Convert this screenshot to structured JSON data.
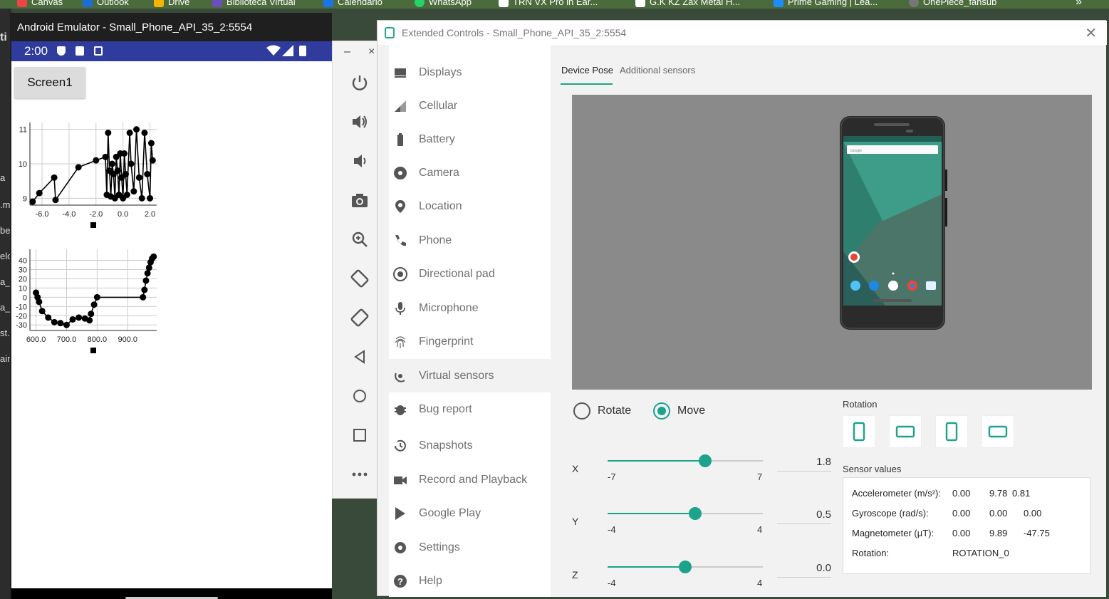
{
  "bookmarks": [
    {
      "label": "Canvas",
      "color": "#e44"
    },
    {
      "label": "Outlook",
      "color": "#1a6fd4"
    },
    {
      "label": "Drive",
      "color": "#f4b400"
    },
    {
      "label": "Biblioteca Virtual",
      "color": "#6b4fbb"
    },
    {
      "label": "Calendario",
      "color": "#1a73e8"
    },
    {
      "label": "WhatsApp",
      "color": "#25d366"
    },
    {
      "label": "TRN VX Pro in Ear...",
      "color": "#111"
    },
    {
      "label": "G.K KZ Zax Metal H...",
      "color": "#111"
    },
    {
      "label": "Prime Gaming | Lea...",
      "color": "#1a8cff"
    },
    {
      "label": "OnePiece_fansub",
      "color": "#777"
    }
  ],
  "bookmarks_more": "»",
  "background_strip": [
    "ti",
    "a",
    ".m",
    "be.",
    "elo",
    "a_l",
    "a_l",
    "st.",
    "ain"
  ],
  "emulator": {
    "title": "Android Emulator - Small_Phone_API_35_2:5554",
    "status_time": "2:00",
    "screen_button": "Screen1",
    "toolbar_window_controls": [
      "–",
      "×"
    ]
  },
  "charts": [
    {
      "type": "line",
      "x_ticks": [
        "-6.0",
        "-4.0",
        "-2.0",
        "0.0",
        "2.0"
      ],
      "y_ticks": [
        "9",
        "10",
        "11"
      ],
      "xlim": [
        -6.9,
        2.5
      ],
      "ylim": [
        8.8,
        11.2
      ],
      "x": [
        -6.7,
        -6.2,
        -5.1,
        -5.0,
        -3.3,
        -2.0,
        -1.3,
        -1.2,
        -1.1,
        -1.0,
        -0.9,
        -0.8,
        -0.7,
        -0.6,
        -0.5,
        -0.4,
        -0.3,
        -0.2,
        -0.1,
        0.0,
        0.1,
        0.2,
        0.3,
        0.5,
        0.6,
        0.8,
        1.0,
        1.2,
        1.4,
        1.6,
        1.8,
        2.0,
        2.1,
        2.2
      ],
      "y": [
        8.9,
        9.15,
        9.6,
        8.95,
        9.9,
        10.1,
        10.2,
        9.1,
        10.9,
        9.8,
        9.05,
        10.0,
        9.7,
        9.0,
        10.2,
        9.8,
        9.1,
        10.3,
        9.6,
        9.0,
        10.3,
        9.7,
        9.1,
        10.9,
        10.0,
        9.2,
        11.0,
        9.6,
        9.0,
        10.9,
        9.7,
        9.0,
        10.6,
        10.1
      ]
    },
    {
      "type": "line",
      "x_ticks": [
        "600.0",
        "700.0",
        "800.0",
        "900.0"
      ],
      "y_ticks": [
        "40",
        "30",
        "20",
        "10",
        "0",
        "-10",
        "-20",
        "-30"
      ],
      "xlim": [
        580,
        995
      ],
      "ylim": [
        -36,
        52
      ],
      "x": [
        600,
        605,
        610,
        620,
        640,
        660,
        680,
        700,
        720,
        740,
        760,
        775,
        780,
        790,
        800,
        950,
        955,
        960,
        965,
        970,
        975,
        980,
        985
      ],
      "y": [
        5,
        0,
        -5,
        -15,
        -22,
        -27,
        -28,
        -30,
        -24,
        -22,
        -23,
        -25,
        -18,
        -8,
        0,
        0,
        8,
        18,
        26,
        32,
        38,
        42,
        44
      ]
    }
  ],
  "extended": {
    "title": "Extended Controls - Small_Phone_API_35_2:5554",
    "nav": [
      {
        "label": "Displays",
        "icon": "display-icon"
      },
      {
        "label": "Cellular",
        "icon": "cellular-icon"
      },
      {
        "label": "Battery",
        "icon": "battery-icon"
      },
      {
        "label": "Camera",
        "icon": "camera-icon"
      },
      {
        "label": "Location",
        "icon": "location-icon"
      },
      {
        "label": "Phone",
        "icon": "phone-icon"
      },
      {
        "label": "Directional pad",
        "icon": "dpad-icon"
      },
      {
        "label": "Microphone",
        "icon": "microphone-icon"
      },
      {
        "label": "Fingerprint",
        "icon": "fingerprint-icon"
      },
      {
        "label": "Virtual sensors",
        "icon": "virtual-sensors-icon"
      },
      {
        "label": "Bug report",
        "icon": "bug-icon"
      },
      {
        "label": "Snapshots",
        "icon": "snapshots-icon"
      },
      {
        "label": "Record and Playback",
        "icon": "record-icon"
      },
      {
        "label": "Google Play",
        "icon": "google-play-icon"
      },
      {
        "label": "Settings",
        "icon": "settings-icon"
      },
      {
        "label": "Help",
        "icon": "help-icon"
      }
    ],
    "tabs": [
      "Device Pose",
      "Additional sensors"
    ],
    "mode": {
      "rotate": "Rotate",
      "move": "Move",
      "selected": "Move"
    },
    "sliders": [
      {
        "axis": "X",
        "min": "-7",
        "max": "7",
        "value": "1.8",
        "fraction": 0.628
      },
      {
        "axis": "Y",
        "min": "-4",
        "max": "4",
        "value": "0.5",
        "fraction": 0.5625
      },
      {
        "axis": "Z",
        "min": "-4",
        "max": "4",
        "value": "0.0",
        "fraction": 0.5
      }
    ],
    "rotation_title": "Rotation",
    "sensor_title": "Sensor values",
    "sensors": [
      {
        "name": "Accelerometer (m/s²):",
        "v": [
          "0.00",
          "9.78",
          "0.81"
        ]
      },
      {
        "name": "Gyroscope (rad/s):",
        "v": [
          "0.00",
          "0.00",
          "0.00"
        ]
      },
      {
        "name": "Magnetometer (µT):",
        "v": [
          "0.00",
          "9.89",
          "-47.75"
        ]
      },
      {
        "name": "Rotation:",
        "v": [
          "ROTATION_0",
          "",
          ""
        ]
      }
    ],
    "accent": "#1ba38b"
  }
}
